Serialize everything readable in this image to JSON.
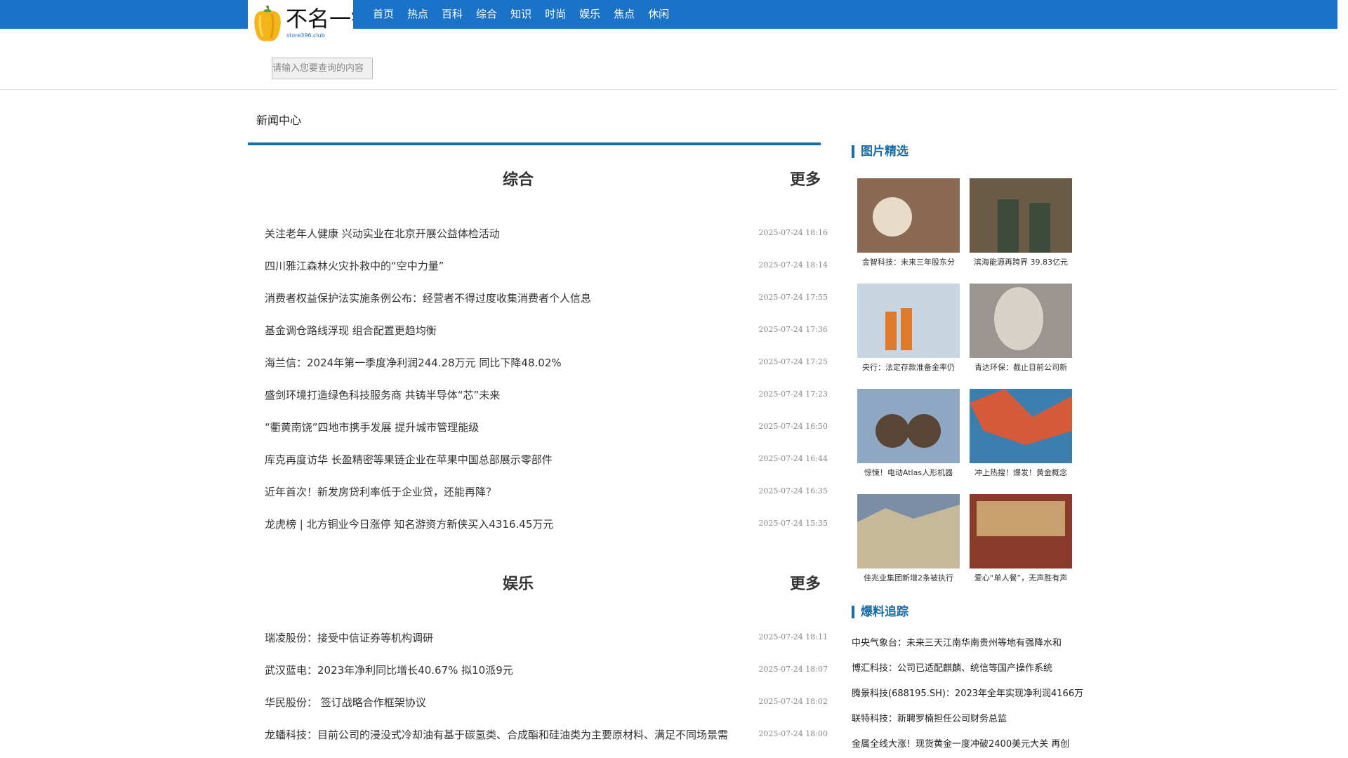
{
  "logo": {
    "text": "不名一钱",
    "url": "store396.club"
  },
  "nav": [
    "首页",
    "热点",
    "百科",
    "综合",
    "知识",
    "时尚",
    "娱乐",
    "焦点",
    "休闲"
  ],
  "search": {
    "placeholder": "请输入您要查询的内容"
  },
  "breadcrumb": "新闻中心",
  "sections": [
    {
      "title": "综合",
      "more": "更多",
      "items": [
        {
          "title": "关注老年人健康 兴动实业在北京开展公益体检活动",
          "date": "2025-07-24 18:16"
        },
        {
          "title": "四川雅江森林火灾扑救中的“空中力量”",
          "date": "2025-07-24 18:14"
        },
        {
          "title": "消费者权益保护法实施条例公布：经营者不得过度收集消费者个人信息",
          "date": "2025-07-24 17:55"
        },
        {
          "title": "基金调仓路线浮现 组合配置更趋均衡",
          "date": "2025-07-24 17:36"
        },
        {
          "title": "海兰信：2024年第一季度净利润244.28万元 同比下降48.02%",
          "date": "2025-07-24 17:25"
        },
        {
          "title": "盛剑环境打造绿色科技服务商 共铸半导体“芯”未来",
          "date": "2025-07-24 17:23"
        },
        {
          "title": "“衢黄南饶”四地市携手发展 提升城市管理能级",
          "date": "2025-07-24 16:50"
        },
        {
          "title": "库克再度访华 长盈精密等果链企业在苹果中国总部展示零部件",
          "date": "2025-07-24 16:44"
        },
        {
          "title": "近年首次！新发房贷利率低于企业贷，还能再降？",
          "date": "2025-07-24 16:35"
        },
        {
          "title": "龙虎榜 | 北方铜业今日涨停 知名游资方新侠买入4316.45万元",
          "date": "2025-07-24 15:35"
        }
      ]
    },
    {
      "title": "娱乐",
      "more": "更多",
      "items": [
        {
          "title": "瑞凌股份：接受中信证券等机构调研",
          "date": "2025-07-24 18:11"
        },
        {
          "title": "武汉蓝电：2023年净利同比增长40.67% 拟10派9元",
          "date": "2025-07-24 18:07"
        },
        {
          "title": "华民股份： 签订战略合作框架协议",
          "date": "2025-07-24 18:02"
        },
        {
          "title": "龙蟠科技：目前公司的浸没式冷却油有基于碳氢类、合成酯和硅油类为主要原材料、满足不同场景需",
          "date": "2025-07-24 18:00"
        }
      ]
    }
  ],
  "pictures": {
    "title": "图片精选",
    "items": [
      {
        "caption": "金智科技：未来三年股东分",
        "colors": [
          "#8a6a55",
          "#e8dcc8"
        ]
      },
      {
        "caption": "滨海能源再跨界 39.83亿元",
        "colors": [
          "#6b5a45",
          "#3e4a3a"
        ]
      },
      {
        "caption": "央行：法定存款准备金率仍",
        "colors": [
          "#c9d6e2",
          "#e07a2a"
        ]
      },
      {
        "caption": "青达环保：截止目前公司新",
        "colors": [
          "#9a9590",
          "#d8d2c8"
        ]
      },
      {
        "caption": "惊悚！电动Atlas人形机器",
        "colors": [
          "#8ea7c2",
          "#5a4535"
        ]
      },
      {
        "caption": "冲上热搜！爆发！黄金概念",
        "colors": [
          "#3a7fb0",
          "#d45a3a"
        ]
      },
      {
        "caption": "佳兆业集团新增2条被执行",
        "colors": [
          "#c8b89a",
          "#7a8fa5"
        ]
      },
      {
        "caption": "爱心“单人餐”，无声胜有声",
        "colors": [
          "#8a3a2a",
          "#c8a070"
        ]
      }
    ]
  },
  "tips": {
    "title": "爆料追踪",
    "items": [
      "中央气象台：未来三天江南华南贵州等地有强降水和",
      "博汇科技：公司已适配麒麟、统信等国产操作系统",
      "腾景科技(688195.SH)：2023年全年实现净利润4166万",
      "联特科技：新聘罗楠担任公司财务总监",
      "金属全线大涨！现货黄金一度冲破2400美元大关 再创"
    ]
  },
  "colors": {
    "brand": "#1a73c8",
    "accent": "#1a6ea8"
  }
}
